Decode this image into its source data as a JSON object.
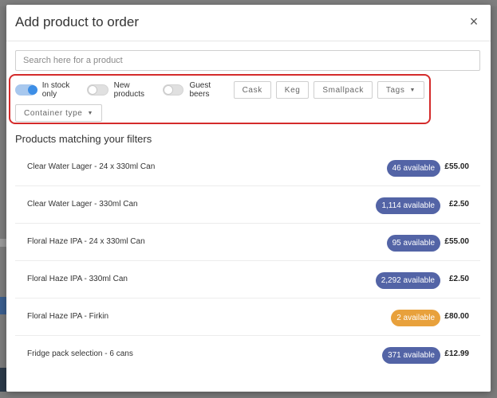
{
  "modal": {
    "title": "Add product to order",
    "close_glyph": "×"
  },
  "search": {
    "placeholder": "Search here for a product",
    "value": ""
  },
  "filters": {
    "toggles": [
      {
        "label": "In stock only",
        "on": true
      },
      {
        "label": "New products",
        "on": false
      },
      {
        "label": "Guest beers",
        "on": false
      }
    ],
    "chips": [
      "Cask",
      "Keg",
      "Smallpack"
    ],
    "dropdowns": [
      "Tags",
      "Container type"
    ]
  },
  "section_title": "Products matching your filters",
  "colors": {
    "available": "#5364a6",
    "low_stock": "#e8a13c",
    "highlight_border": "#d42b2b"
  },
  "products": [
    {
      "name": "Clear Water Lager - 24 x 330ml Can",
      "availability": "46 available",
      "price": "£55.00",
      "status": "available"
    },
    {
      "name": "Clear Water Lager - 330ml Can",
      "availability": "1,114 available",
      "price": "£2.50",
      "status": "available"
    },
    {
      "name": "Floral Haze IPA - 24 x 330ml Can",
      "availability": "95 available",
      "price": "£55.00",
      "status": "available"
    },
    {
      "name": "Floral Haze IPA - 330ml Can",
      "availability": "2,292 available",
      "price": "£2.50",
      "status": "available"
    },
    {
      "name": "Floral Haze IPA - Firkin",
      "availability": "2 available",
      "price": "£80.00",
      "status": "low_stock"
    },
    {
      "name": "Fridge pack selection - 6 cans",
      "availability": "371 available",
      "price": "£12.99",
      "status": "available"
    }
  ]
}
